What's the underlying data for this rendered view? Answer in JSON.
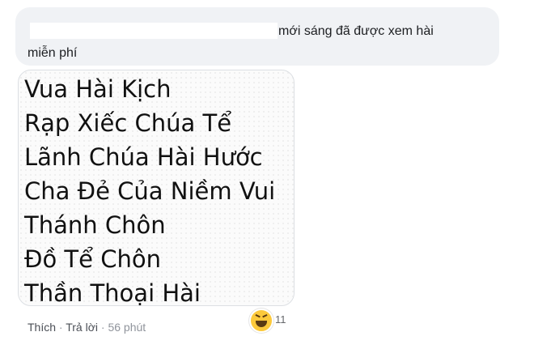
{
  "comment": {
    "text_line1": "mới sáng đã được xem hài",
    "text_line2": "miễn phí"
  },
  "image_lines": [
    "Vua Hài Kịch",
    "Rạp Xiếc Chúa Tể",
    "Lãnh Chúa Hài Hước",
    "Cha Đẻ Của Niềm Vui",
    "Thánh Chôn",
    "Đồ Tể Chôn",
    "Thần Thoại Hài"
  ],
  "reaction": {
    "icon": "haha-icon",
    "count": "11"
  },
  "actions": {
    "like": "Thích",
    "reply": "Trả lời",
    "separator": "·",
    "time": "56 phút"
  }
}
